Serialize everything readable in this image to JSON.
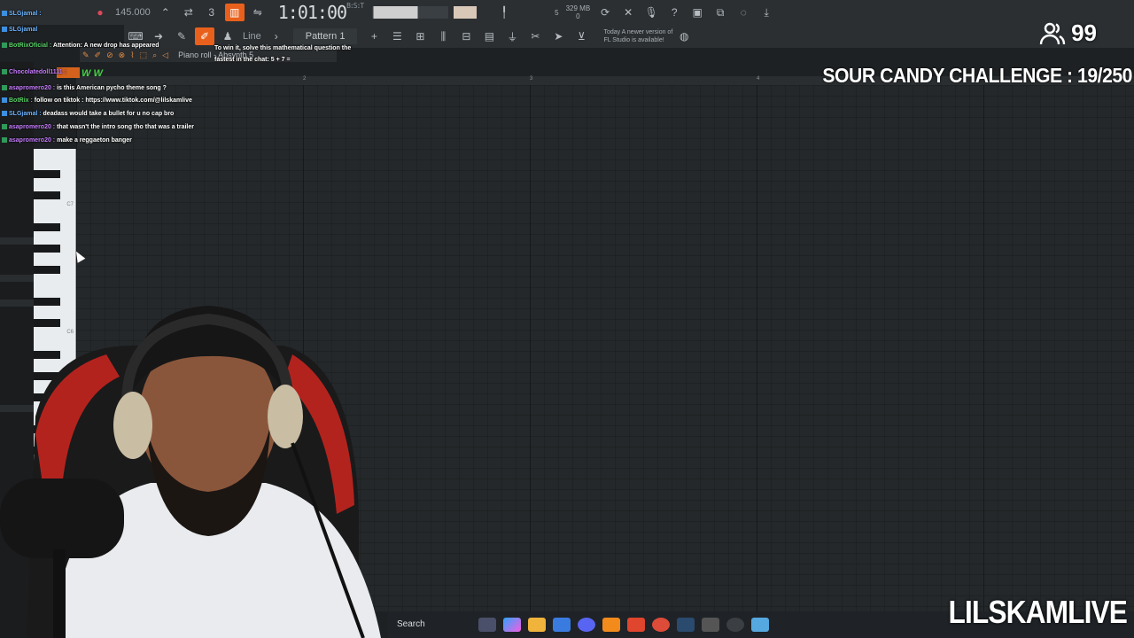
{
  "toolbar": {
    "tempo": "145.000",
    "time_main": "1:01:00",
    "time_sub": "B:S:T",
    "pattern": "Pattern 1",
    "line_mode": "Line",
    "cpu_mem": "329 MB",
    "cpu_num": "5",
    "cpu_zero": "0",
    "news_line1": "Today  A newer version of",
    "news_line2": "FL Studio is available!"
  },
  "piano_roll": {
    "title": "Piano roll - Absynth 5",
    "bar_numbers": [
      "2",
      "3",
      "4"
    ],
    "key_labels": [
      "C7",
      "C6"
    ]
  },
  "chat": {
    "header_user": "SLGjamal",
    "messages": [
      {
        "user": "SLGjamal :",
        "text": "",
        "color": "blue"
      },
      {
        "user": "BotRixOficial :",
        "text": "Attention: A new drop has appeared",
        "color": "green"
      },
      {
        "user": "",
        "text": "To win it, solve this mathematical question the fastest in the chat: 5 + 7 =",
        "color": "white"
      },
      {
        "user": "Chocolatedoll1111 :",
        "text": "",
        "color": "purple"
      },
      {
        "user": "asapromero20 :",
        "text": "is this American pycho theme song ?",
        "color": "purple"
      },
      {
        "user": "BotRix :",
        "text": "follow on tiktok : https://www.tiktok.com/@lilskamlive",
        "color": "green"
      },
      {
        "user": "SLGjamal :",
        "text": "deadass would take a bullet for u no cap bro",
        "color": "blue"
      },
      {
        "user": "asapromero20 :",
        "text": "that wasn't the intro song tho that was a trailer",
        "color": "purple"
      },
      {
        "user": "asapromero20 :",
        "text": "make a reggaeton banger",
        "color": "purple"
      }
    ],
    "ww": "W W"
  },
  "overlay": {
    "viewer_count": "99",
    "challenge": "SOUR CANDY CHALLENGE : 19/250",
    "channel": "LILSKAMLIVE"
  },
  "taskbar": {
    "search": "Search",
    "apps": [
      "copilot",
      "files",
      "store",
      "discord",
      "fl-studio",
      "brave",
      "chrome",
      "steam",
      "other",
      "4k",
      "notepad"
    ]
  },
  "colors": {
    "accent": "#e8601c",
    "grid_bg": "#24282a",
    "chat_green": "#43d143"
  }
}
